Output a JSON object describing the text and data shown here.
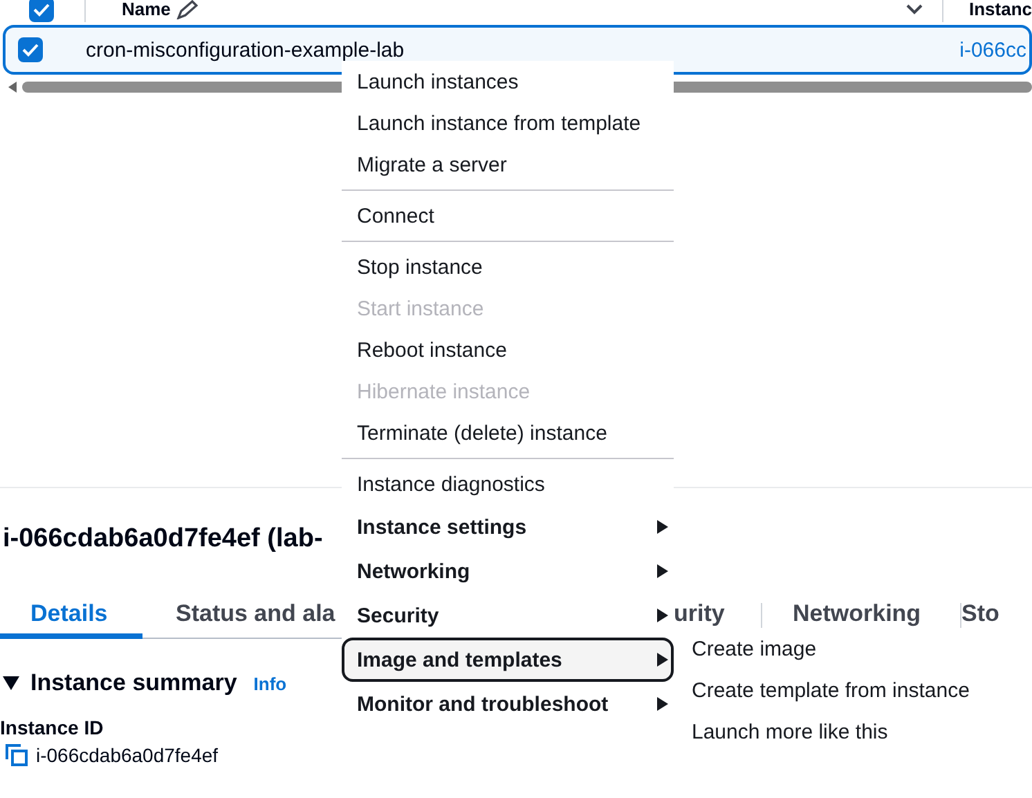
{
  "table": {
    "columns": [
      "Name",
      "Instanc"
    ],
    "all_selected": true,
    "rows": [
      {
        "name": "cron-misconfiguration-example-lab",
        "instance_id": "i-066cc",
        "selected": true
      }
    ]
  },
  "details": {
    "title": "i-066cdab6a0d7fe4ef (lab-",
    "tabs": [
      {
        "label": "Details",
        "selected": true
      },
      {
        "label": "Status and ala",
        "selected": false
      },
      {
        "label": "urity",
        "selected": false
      },
      {
        "label": "Networking",
        "selected": false
      },
      {
        "label": "Sto",
        "selected": false
      }
    ],
    "section": {
      "title": "Instance summary",
      "expanded": true,
      "info": "Info"
    },
    "fields": [
      {
        "label": "Instance ID",
        "value": "i-066cdab6a0d7fe4ef"
      }
    ]
  },
  "context_menu": {
    "groups": [
      [
        {
          "label": "Launch instances",
          "kind": "action",
          "disabled": false,
          "selected": false
        },
        {
          "label": "Launch instance from template",
          "kind": "action",
          "disabled": false,
          "selected": false
        },
        {
          "label": "Migrate a server",
          "kind": "action",
          "disabled": false,
          "selected": false
        }
      ],
      [
        {
          "label": "Connect",
          "kind": "action",
          "disabled": false,
          "selected": false
        }
      ],
      [
        {
          "label": "Stop instance",
          "kind": "action",
          "disabled": false,
          "selected": false
        },
        {
          "label": "Start instance",
          "kind": "action",
          "disabled": true,
          "selected": false
        },
        {
          "label": "Reboot instance",
          "kind": "action",
          "disabled": false,
          "selected": false
        },
        {
          "label": "Hibernate instance",
          "kind": "action",
          "disabled": true,
          "selected": false
        },
        {
          "label": "Terminate (delete) instance",
          "kind": "action",
          "disabled": false,
          "selected": false
        }
      ],
      [
        {
          "label": "Instance diagnostics",
          "kind": "action",
          "disabled": false,
          "selected": false
        },
        {
          "label": "Instance settings",
          "kind": "submenu",
          "disabled": false,
          "selected": false
        },
        {
          "label": "Networking",
          "kind": "submenu",
          "disabled": false,
          "selected": false
        },
        {
          "label": "Security",
          "kind": "submenu",
          "disabled": false,
          "selected": false
        },
        {
          "label": "Image and templates",
          "kind": "submenu",
          "disabled": false,
          "selected": true
        },
        {
          "label": "Monitor and troubleshoot",
          "kind": "submenu",
          "disabled": false,
          "selected": false
        }
      ]
    ],
    "submenu": [
      "Create image",
      "Create template from instance",
      "Launch more like this"
    ]
  }
}
